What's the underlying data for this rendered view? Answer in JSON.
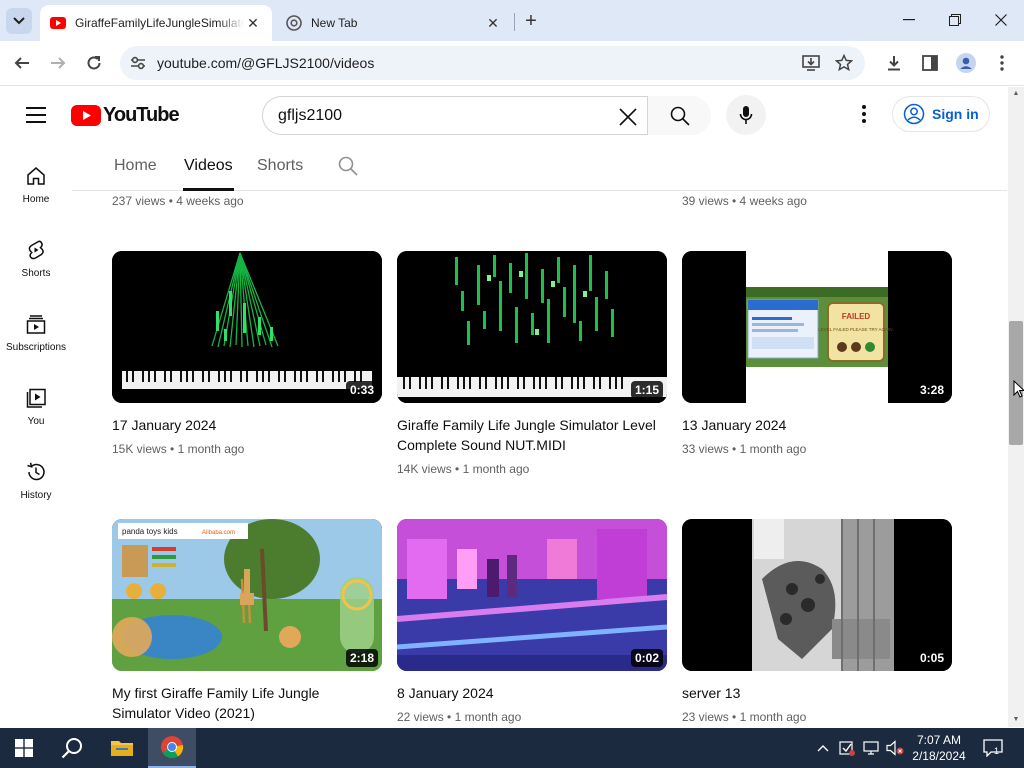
{
  "browser": {
    "tabs": [
      {
        "title": "GiraffeFamilyLifeJungleSimulator",
        "active": true
      },
      {
        "title": "New Tab",
        "active": false
      }
    ],
    "url": "youtube.com/@GFLJS2100/videos"
  },
  "youtube": {
    "logo_text": "YouTube",
    "search_query": "gfljs2100",
    "signin_label": "Sign in",
    "guide": [
      {
        "label": "Home",
        "icon": "home-icon"
      },
      {
        "label": "Shorts",
        "icon": "shorts-icon"
      },
      {
        "label": "Subscriptions",
        "icon": "subscriptions-icon"
      },
      {
        "label": "You",
        "icon": "you-icon"
      },
      {
        "label": "History",
        "icon": "history-icon"
      }
    ],
    "channel_tabs": [
      {
        "label": "Home",
        "selected": false
      },
      {
        "label": "Videos",
        "selected": true
      },
      {
        "label": "Shorts",
        "selected": false
      }
    ],
    "previous_row_meta": [
      "237 views • 4 weeks ago",
      "39 views • 4 weeks ago"
    ],
    "videos": [
      {
        "title": "17 January 2024",
        "views": "15K views",
        "age": "1 month ago",
        "duration": "0:33",
        "thumb": "piano-visualizer"
      },
      {
        "title": "Giraffe Family Life Jungle Simulator Level Complete Sound NUT.MIDI",
        "views": "14K views",
        "age": "1 month ago",
        "duration": "1:15",
        "thumb": "piano-midi-bars"
      },
      {
        "title": "13 January 2024",
        "views": "33 views",
        "age": "1 month ago",
        "duration": "3:28",
        "thumb": "failed-screen"
      },
      {
        "title": "My first Giraffe Family Life Jungle Simulator Video (2021)",
        "views": "",
        "age": "",
        "duration": "2:18",
        "thumb": "giraffe-game"
      },
      {
        "title": "8 January 2024",
        "views": "22 views",
        "age": "1 month ago",
        "duration": "0:02",
        "thumb": "glitch-purple"
      },
      {
        "title": "server 13",
        "views": "23 views",
        "age": "1 month ago",
        "duration": "0:05",
        "thumb": "glitch-giraffe"
      }
    ],
    "thumb_text": {
      "ad_label": "panda toys kids",
      "ad_site": "Alibaba.com",
      "failed_title": "FAILED",
      "failed_sub": "LEVEL FAILED PLEASE TRY AGAIN."
    }
  },
  "taskbar": {
    "time": "7:07 AM",
    "date": "2/18/2024",
    "notification_count": "1"
  }
}
